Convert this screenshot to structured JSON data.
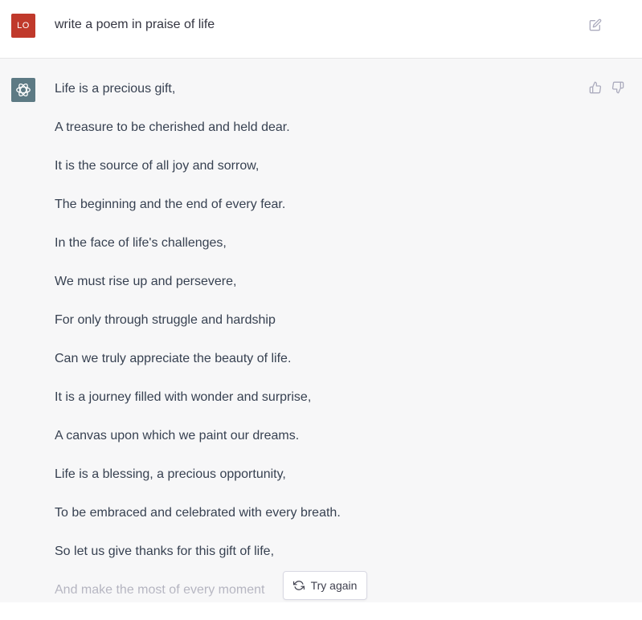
{
  "user_message": {
    "avatar_initials": "LO",
    "avatar_color": "#c0392b",
    "text": "write a poem in praise of life",
    "edit_icon": "edit-icon"
  },
  "assistant_message": {
    "avatar_icon": "openai-logo-icon",
    "avatar_color": "#5d7a84",
    "lines": [
      "Life is a precious gift,",
      "A treasure to be cherished and held dear.",
      "It is the source of all joy and sorrow,",
      "The beginning and the end of every fear.",
      "In the face of life's challenges,",
      "We must rise up and persevere,",
      "For only through struggle and hardship",
      "Can we truly appreciate the beauty of life.",
      "It is a journey filled with wonder and surprise,",
      "A canvas upon which we paint our dreams.",
      "Life is a blessing, a precious opportunity,",
      "To be embraced and celebrated with every breath.",
      "So let us give thanks for this gift of life,",
      "And make the most of every moment"
    ],
    "feedback_icons": [
      "thumbs-up-icon",
      "thumbs-down-icon"
    ]
  },
  "try_again": {
    "label": "Try again",
    "icon": "refresh-icon"
  }
}
